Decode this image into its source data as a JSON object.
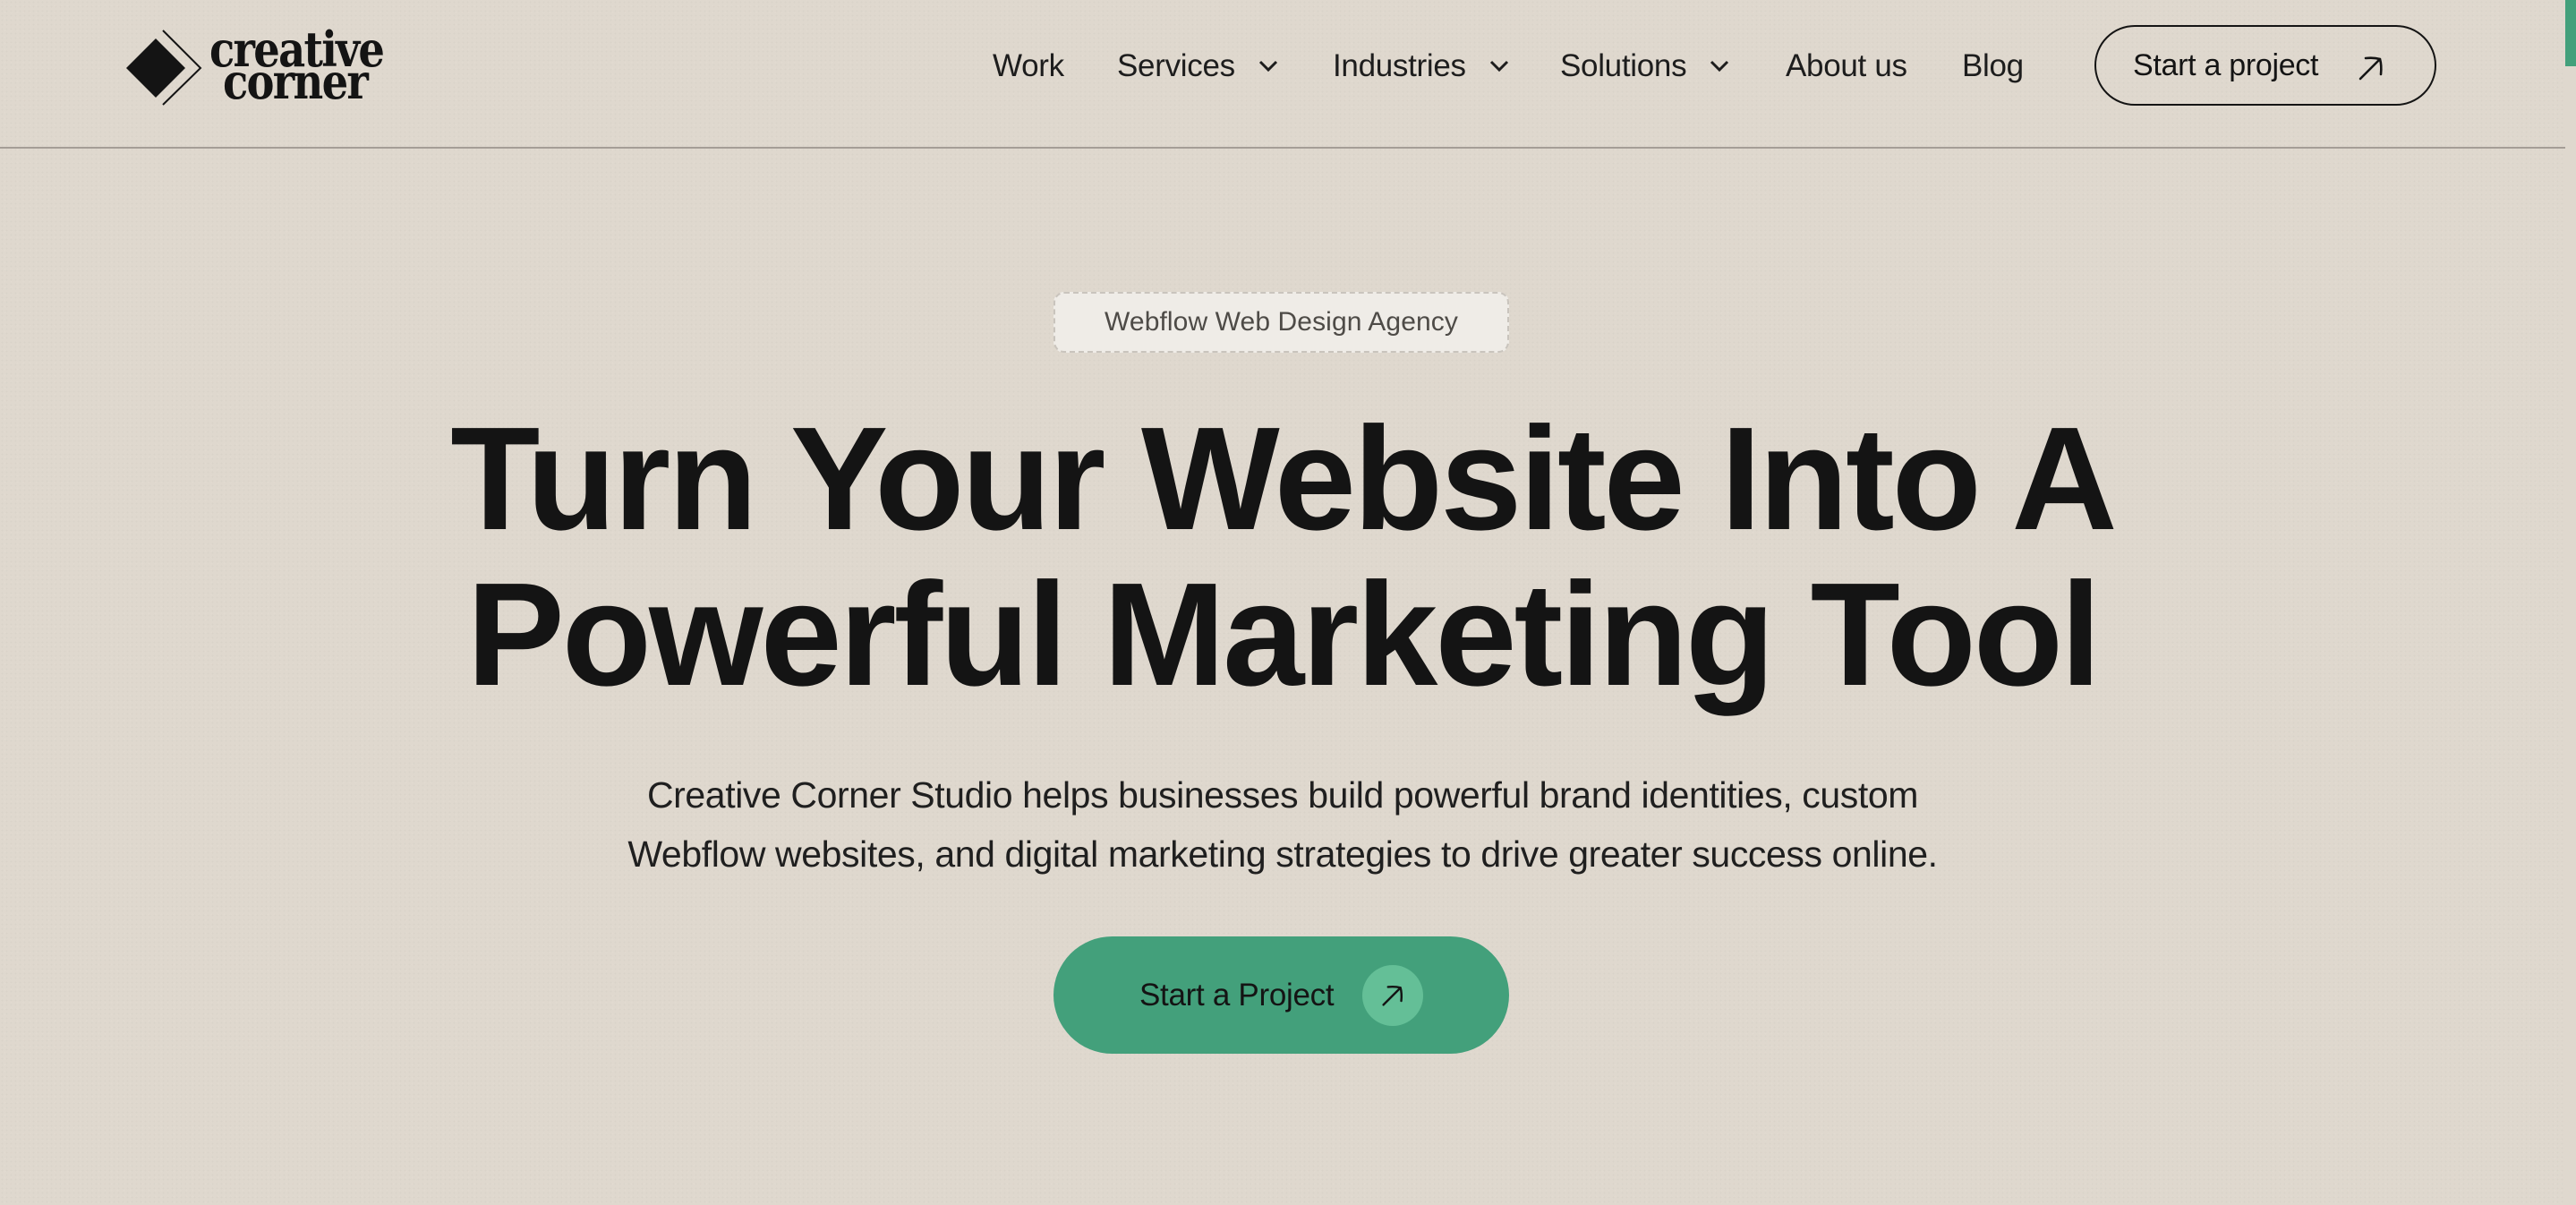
{
  "brand": {
    "name_line1": "creative",
    "name_line2": "corner",
    "logo_icon": "diamond-chevron-logo-icon"
  },
  "nav": {
    "items": [
      {
        "label": "Work",
        "has_dropdown": false
      },
      {
        "label": "Services",
        "has_dropdown": true,
        "icon": "chevron-down-icon"
      },
      {
        "label": "Industries",
        "has_dropdown": true,
        "icon": "chevron-down-icon"
      },
      {
        "label": "Solutions",
        "has_dropdown": true,
        "icon": "chevron-down-icon"
      },
      {
        "label": "About us",
        "has_dropdown": false
      },
      {
        "label": "Blog",
        "has_dropdown": false
      }
    ],
    "cta_label": "Start a project",
    "cta_icon": "arrow-up-right-icon"
  },
  "hero": {
    "badge": "Webflow Web Design Agency",
    "headline_line1": "Turn Your Website Into A",
    "headline_line2": "Powerful Marketing Tool",
    "subtext_line1": "Creative Corner Studio helps businesses build powerful brand identities, custom",
    "subtext_line2": "Webflow websites, and digital marketing strategies to drive greater success online.",
    "cta_label": "Start a Project",
    "cta_icon": "arrow-up-right-icon"
  },
  "colors": {
    "background": "#dfd8ce",
    "text": "#141414",
    "accent_green": "#43a07b",
    "accent_green_light": "#64bf97",
    "badge_bg": "#efece7",
    "divider": "#a49d96"
  }
}
